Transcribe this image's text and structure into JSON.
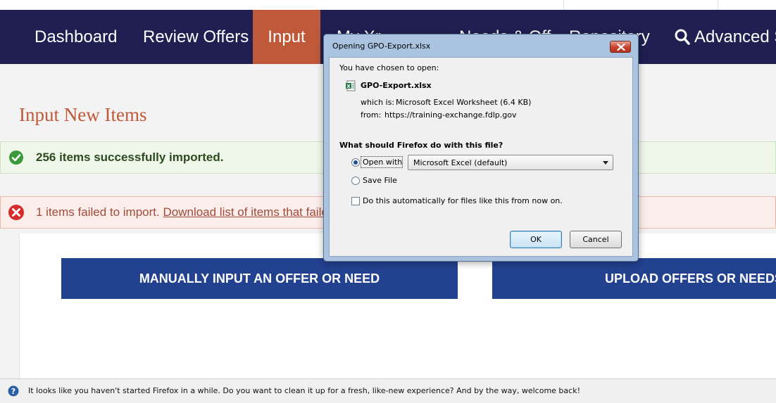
{
  "nav": {
    "items": [
      {
        "label": "Dashboard"
      },
      {
        "label": "Review Offers"
      },
      {
        "label": "Input"
      },
      {
        "label": "My Xr"
      },
      {
        "label": "Needs & Off"
      },
      {
        "label": "Repository"
      }
    ],
    "search_label": "Advanced Se",
    "active_color": "#c0593a",
    "bg_color": "#1f1f52"
  },
  "page": {
    "title": "Input New Items",
    "success_message": "256 items successfully imported.",
    "error_message": "1 items failed to import.",
    "error_link": "Download list of items that failed",
    "manual_button": "MANUALLY INPUT AN OFFER OR NEED",
    "upload_button": "UPLOAD OFFERS OR NEEDS"
  },
  "dialog": {
    "title": "Opening GPO-Export.xlsx",
    "chosen_label": "You have chosen to open:",
    "file_name": "GPO-Export.xlsx",
    "which_is_label": "which is:",
    "which_is_value": "Microsoft Excel Worksheet (6.4 KB)",
    "from_label": "from:",
    "from_value": "https://training-exchange.fdlp.gov",
    "question": "What should Firefox do with this file?",
    "open_with_label": "Open with",
    "open_with_value": "Microsoft Excel (default)",
    "save_file_label": "Save File",
    "auto_label": "Do this automatically for files like this from now on.",
    "ok_label": "OK",
    "cancel_label": "Cancel"
  },
  "notification": {
    "message": "It looks like you haven't started Firefox in a while. Do you want to clean it up for a fresh, like-new experience? And by the way, welcome back!"
  }
}
